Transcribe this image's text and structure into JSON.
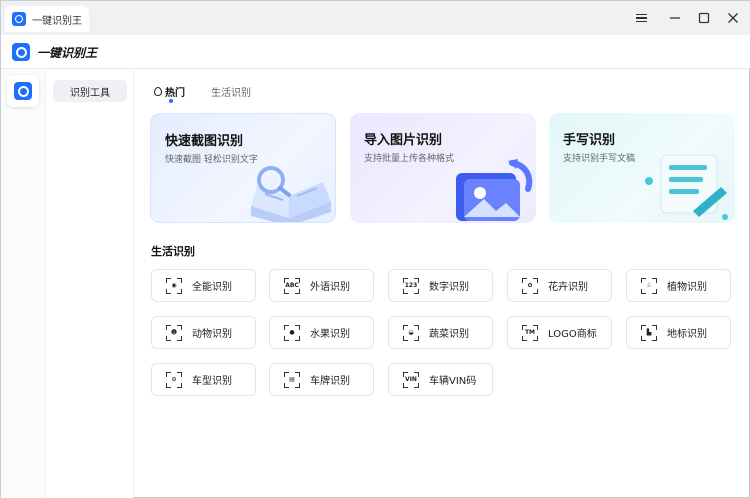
{
  "window": {
    "tab_title": "一键识别王",
    "controls": [
      "menu-icon",
      "minimize-icon",
      "maximize-icon",
      "close-icon"
    ]
  },
  "header": {
    "app_name": "一键识别王"
  },
  "subnav": {
    "items": [
      {
        "label": "识别工具",
        "active": true
      }
    ]
  },
  "tabs": [
    {
      "label": "热门",
      "active": true
    },
    {
      "label": "生活识别",
      "active": false
    }
  ],
  "cards": [
    {
      "title": "快速截图识别",
      "subtitle": "快速截图 轻松识别文字",
      "icon": "open-book-magnifier-icon"
    },
    {
      "title": "导入图片识别",
      "subtitle": "支持批量上传各种格式",
      "icon": "image-import-icon"
    },
    {
      "title": "手写识别",
      "subtitle": "支持识别手写文稿",
      "icon": "handwriting-scroll-icon"
    }
  ],
  "section": {
    "title": "生活识别"
  },
  "tools": [
    {
      "label": "全能识别",
      "glyph": "◉",
      "icon": "eye-scan-icon"
    },
    {
      "label": "外语识别",
      "glyph": "ABC",
      "icon": "abc-scan-icon"
    },
    {
      "label": "数字识别",
      "glyph": "123",
      "icon": "number-scan-icon"
    },
    {
      "label": "花卉识别",
      "glyph": "✿",
      "icon": "flower-scan-icon"
    },
    {
      "label": "植物识别",
      "glyph": "♧",
      "icon": "plant-scan-icon"
    },
    {
      "label": "动物识别",
      "glyph": "☻",
      "icon": "animal-scan-icon"
    },
    {
      "label": "水果识别",
      "glyph": "●",
      "icon": "fruit-scan-icon"
    },
    {
      "label": "蔬菜识别",
      "glyph": "◒",
      "icon": "vegetable-scan-icon"
    },
    {
      "label": "LOGO商标",
      "glyph": "TM",
      "icon": "logo-scan-icon"
    },
    {
      "label": "地标识别",
      "glyph": "▙",
      "icon": "landmark-scan-icon"
    },
    {
      "label": "车型识别",
      "glyph": "⊙",
      "icon": "car-scan-icon"
    },
    {
      "label": "车牌识别",
      "glyph": "▤",
      "icon": "license-plate-scan-icon"
    },
    {
      "label": "车辆VIN码",
      "glyph": "VIN",
      "icon": "vin-scan-icon"
    }
  ],
  "colors": {
    "accent": "#1f6fff",
    "titlebar": "#f0f1f3"
  }
}
